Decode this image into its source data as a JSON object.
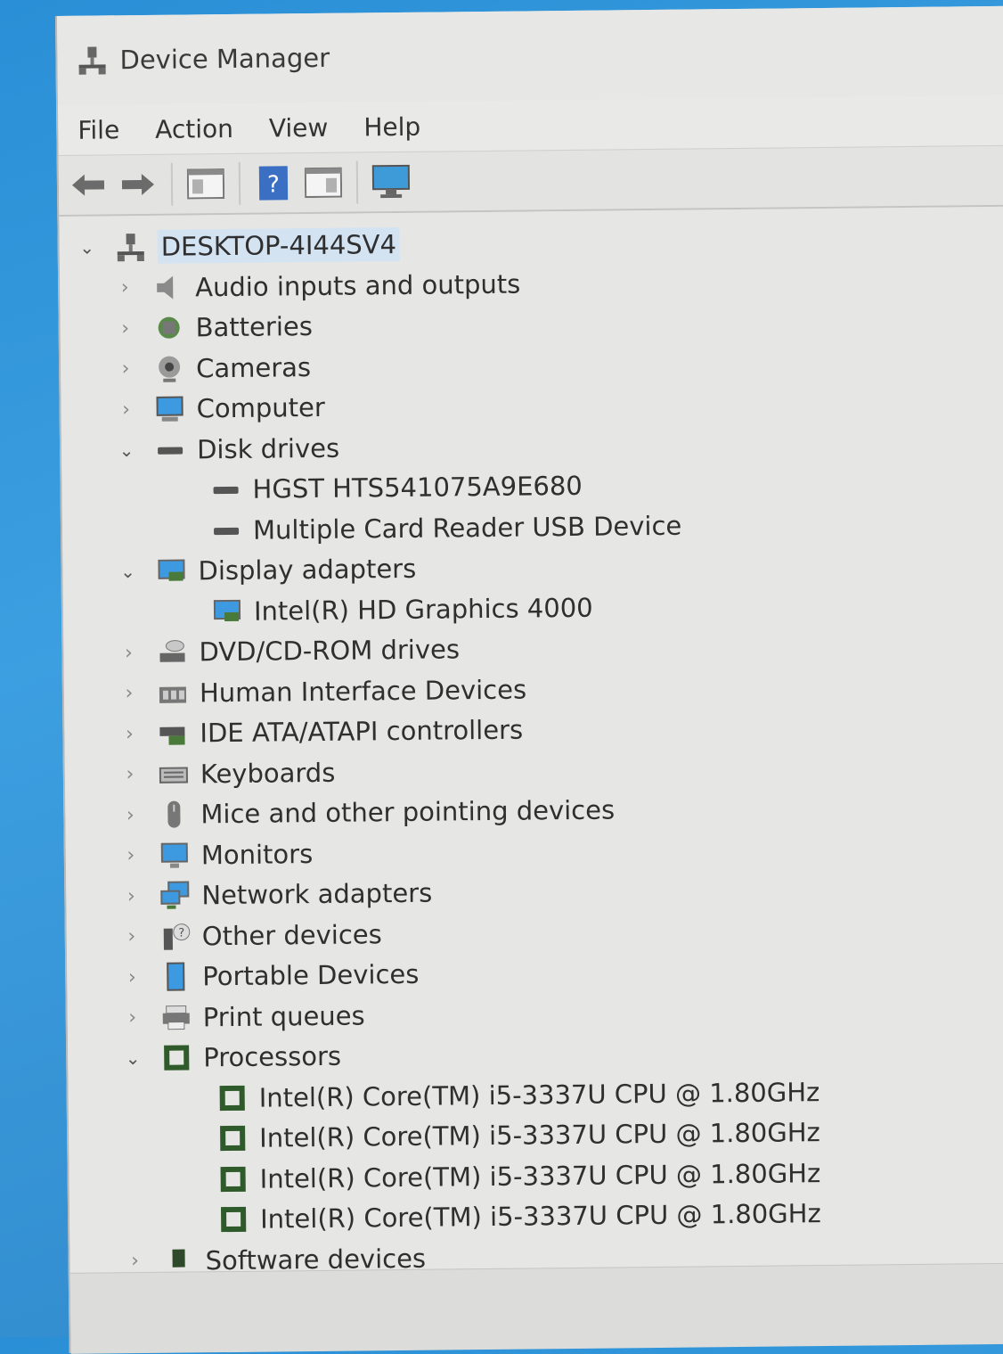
{
  "window": {
    "title": "Device Manager"
  },
  "menu": [
    "File",
    "Action",
    "View",
    "Help"
  ],
  "toolbar": {
    "icons": [
      "back-icon",
      "forward-icon",
      "show-hide-console-tree-icon",
      "help-icon",
      "properties-icon",
      "scan-hardware-icon"
    ]
  },
  "tree": {
    "root": "DESKTOP-4I44SV4",
    "rows": [
      {
        "level": 1,
        "expanded": false,
        "label": "Audio inputs and outputs",
        "icon": "speaker-icon"
      },
      {
        "level": 1,
        "expanded": false,
        "label": "Batteries",
        "icon": "battery-icon"
      },
      {
        "level": 1,
        "expanded": false,
        "label": "Cameras",
        "icon": "camera-icon"
      },
      {
        "level": 1,
        "expanded": false,
        "label": "Computer",
        "icon": "computer-icon"
      },
      {
        "level": 1,
        "expanded": true,
        "label": "Disk drives",
        "icon": "disk-drive-icon"
      },
      {
        "level": 2,
        "label": "HGST HTS541075A9E680",
        "icon": "disk-drive-icon"
      },
      {
        "level": 2,
        "label": "Multiple Card  Reader USB Device",
        "icon": "disk-drive-icon"
      },
      {
        "level": 1,
        "expanded": true,
        "label": "Display adapters",
        "icon": "display-adapter-icon"
      },
      {
        "level": 2,
        "label": "Intel(R) HD Graphics 4000",
        "icon": "display-adapter-icon"
      },
      {
        "level": 1,
        "expanded": false,
        "label": "DVD/CD-ROM drives",
        "icon": "dvd-drive-icon"
      },
      {
        "level": 1,
        "expanded": false,
        "label": "Human Interface Devices",
        "icon": "hid-icon"
      },
      {
        "level": 1,
        "expanded": false,
        "label": "IDE ATA/ATAPI controllers",
        "icon": "ide-controller-icon"
      },
      {
        "level": 1,
        "expanded": false,
        "label": "Keyboards",
        "icon": "keyboard-icon"
      },
      {
        "level": 1,
        "expanded": false,
        "label": "Mice and other pointing devices",
        "icon": "mouse-icon"
      },
      {
        "level": 1,
        "expanded": false,
        "label": "Monitors",
        "icon": "monitor-icon"
      },
      {
        "level": 1,
        "expanded": false,
        "label": "Network adapters",
        "icon": "network-adapter-icon"
      },
      {
        "level": 1,
        "expanded": false,
        "label": "Other devices",
        "icon": "other-devices-icon"
      },
      {
        "level": 1,
        "expanded": false,
        "label": "Portable Devices",
        "icon": "portable-device-icon"
      },
      {
        "level": 1,
        "expanded": false,
        "label": "Print queues",
        "icon": "printer-icon"
      },
      {
        "level": 1,
        "expanded": true,
        "label": "Processors",
        "icon": "processor-icon"
      },
      {
        "level": 2,
        "label": "Intel(R) Core(TM) i5-3337U CPU @ 1.80GHz",
        "icon": "processor-icon"
      },
      {
        "level": 2,
        "label": "Intel(R) Core(TM) i5-3337U CPU @ 1.80GHz",
        "icon": "processor-icon"
      },
      {
        "level": 2,
        "label": "Intel(R) Core(TM) i5-3337U CPU @ 1.80GHz",
        "icon": "processor-icon"
      },
      {
        "level": 2,
        "label": "Intel(R) Core(TM) i5-3337U CPU @ 1.80GHz",
        "icon": "processor-icon"
      },
      {
        "level": 1,
        "expanded": false,
        "label": "Software devices",
        "icon": "software-device-icon"
      }
    ]
  },
  "colors": {
    "desktop": "#2f8fd6",
    "window_bg": "#e6e6e4",
    "selection": "#d4e3f2",
    "text": "#2f2f2f"
  }
}
